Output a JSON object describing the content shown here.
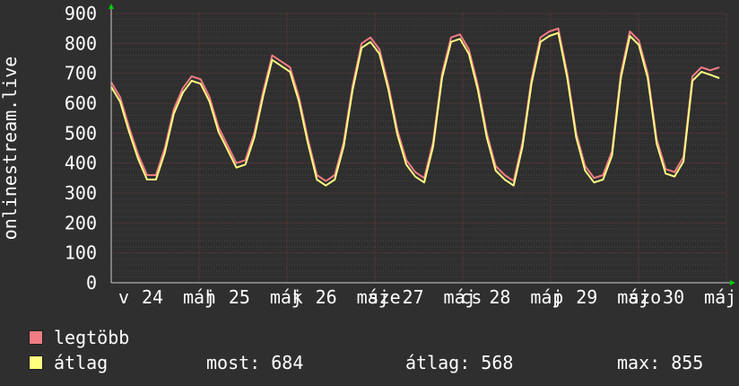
{
  "chart_data": {
    "type": "line",
    "ylabel": "onlinestream.live",
    "ylim": [
      0,
      900
    ],
    "yticks": [
      0,
      100,
      200,
      300,
      400,
      500,
      600,
      700,
      800,
      900
    ],
    "grid": true,
    "xticks": [
      "v",
      "24",
      "máj",
      "h",
      "25",
      "máj",
      "k",
      "26",
      "máj",
      "sze",
      "27",
      "máj",
      "cs",
      "28",
      "máj",
      "p",
      "29",
      "máj",
      "szo",
      "30",
      "máj"
    ],
    "x": [
      "V 24 00",
      "V 24 03",
      "V 24 06",
      "V 24 09",
      "V 24 12",
      "V 24 15",
      "V 24 18",
      "V 24 21",
      "H 25 00",
      "H 25 03",
      "H 25 06",
      "H 25 09",
      "H 25 12",
      "H 25 15",
      "H 25 18",
      "H 25 21",
      "K 26 00",
      "K 26 03",
      "K 26 06",
      "K 26 09",
      "K 26 12",
      "K 26 15",
      "K 26 18",
      "K 26 21",
      "Sze 27 00",
      "Sze 27 03",
      "Sze 27 06",
      "Sze 27 09",
      "Sze 27 12",
      "Sze 27 15",
      "Sze 27 18",
      "Sze 27 21",
      "Cs 28 00",
      "Cs 28 03",
      "Cs 28 06",
      "Cs 28 09",
      "Cs 28 12",
      "Cs 28 15",
      "Cs 28 18",
      "Cs 28 21",
      "P 29 00",
      "P 29 03",
      "P 29 06",
      "P 29 09",
      "P 29 12",
      "P 29 15",
      "P 29 18",
      "P 29 21",
      "Szo 30 00",
      "Szo 30 03",
      "Szo 30 06",
      "Szo 30 09",
      "Szo 30 12",
      "Szo 30 15",
      "Szo 30 18",
      "Szo 30 21",
      "V 31 00"
    ],
    "series": [
      {
        "name": "legtöbb",
        "color": "#f07c84",
        "values": [
          670,
          620,
          520,
          430,
          360,
          360,
          450,
          580,
          650,
          690,
          680,
          620,
          520,
          460,
          400,
          410,
          500,
          640,
          760,
          740,
          720,
          620,
          480,
          360,
          340,
          360,
          470,
          660,
          800,
          820,
          780,
          660,
          510,
          410,
          370,
          350,
          470,
          700,
          820,
          830,
          780,
          660,
          500,
          390,
          360,
          340,
          470,
          680,
          820,
          840,
          850,
          700,
          500,
          390,
          350,
          360,
          440,
          700,
          840,
          810,
          700,
          480,
          380,
          370,
          420,
          690,
          720,
          710,
          720
        ]
      },
      {
        "name": "átlag",
        "color": "#ffff80",
        "values": [
          655,
          605,
          505,
          415,
          345,
          345,
          435,
          565,
          635,
          675,
          665,
          605,
          505,
          445,
          385,
          395,
          485,
          625,
          745,
          725,
          705,
          605,
          465,
          345,
          325,
          345,
          455,
          645,
          785,
          805,
          765,
          645,
          495,
          395,
          355,
          335,
          455,
          685,
          805,
          815,
          765,
          645,
          485,
          375,
          345,
          325,
          455,
          665,
          805,
          825,
          835,
          685,
          485,
          375,
          335,
          345,
          425,
          685,
          825,
          795,
          685,
          465,
          365,
          355,
          405,
          675,
          705,
          695,
          684
        ]
      }
    ]
  },
  "legend": {
    "items": [
      {
        "label": "legtöbb",
        "color": "#f07c84"
      },
      {
        "label": "átlag",
        "color": "#ffff80"
      }
    ],
    "stats": {
      "most": "most: 684",
      "atlag": "átlag: 568",
      "max": "max: 855"
    }
  }
}
